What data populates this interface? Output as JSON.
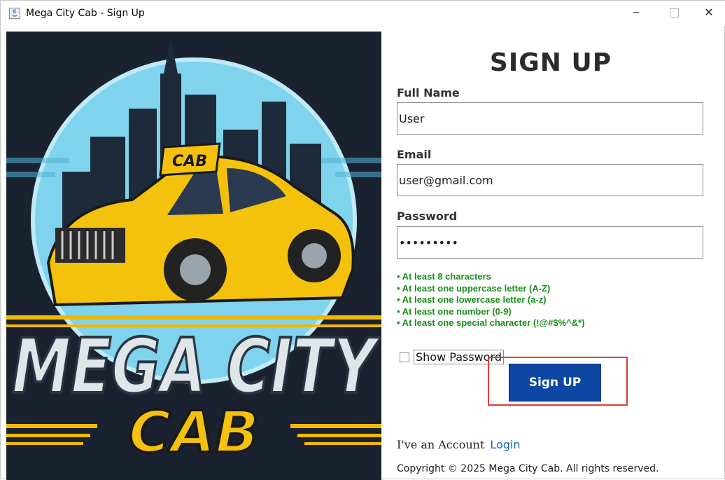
{
  "window": {
    "title": "Mega City Cab - Sign Up",
    "minimize_symbol": "–",
    "close_symbol": "✕"
  },
  "hero": {
    "top_badge": "CAB",
    "brand_line1": "MEGA CITY",
    "brand_line2": "CAB",
    "colors": {
      "background": "#1a2230",
      "sky": "#7fd3ec",
      "taxi": "#f4c20d",
      "accent": "#f2b705"
    }
  },
  "form": {
    "heading": "SIGN UP",
    "full_name_label": "Full Name",
    "full_name_value": "User",
    "email_label": "Email",
    "email_value": "user@gmail.com",
    "password_label": "Password",
    "password_value": "•••••••••",
    "rules": [
      "• At least 8 characters",
      "• At least one uppercase letter (A-Z)",
      "• At least one lowercase letter (a-z)",
      "• At least one number (0-9)",
      "• At least one special character (!@#$%^&*)"
    ],
    "show_password_label": "Show Password",
    "show_password_checked": false,
    "signup_button": "Sign UP",
    "account_text": "I've an Account",
    "login_link": "Login",
    "copyright": "Copyright © 2025 Mega City Cab. All rights reserved."
  },
  "colors": {
    "button": "#0d47a1",
    "rules_text": "#1a8f1a",
    "highlight_box": "#e53935",
    "link": "#1565c0"
  }
}
